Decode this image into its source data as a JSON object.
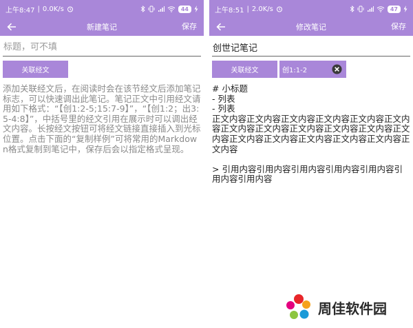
{
  "left": {
    "status": {
      "time": "上午8:47",
      "speed": "0.0K/s",
      "battery": "44"
    },
    "appbar": {
      "title": "新建笔记",
      "save_label": "保存"
    },
    "title_input": {
      "value": "",
      "placeholder": "标题，可不填"
    },
    "verse_button_label": "关联经文",
    "help_text": "添加关联经文后，在阅读时会在该节经文后添加笔记标志，可以快速调出此笔记。笔记正文中引用经文请用如下格式：“【创1:2-5;15:7-9】”，“【创1:2；出3:5-4:8】”，中括号里的经文引用在展示时可以调出经文内容。长按经文按钮可将经文链接直接插入到光标位置。点击下面的“复制样例”可将常用的Markdown格式复制到笔记中，保存后会以指定格式呈现。"
  },
  "right": {
    "status": {
      "time": "上午8:51",
      "speed": "2.0K/s",
      "battery": "47"
    },
    "appbar": {
      "title": "修改笔记",
      "save_label": "保存"
    },
    "title_input": {
      "value": "创世记笔记",
      "placeholder": ""
    },
    "verse_button_label": "关联经文",
    "verse_chip_label": "创1:1-2",
    "body_lines": [
      "# 小标题",
      "- 列表",
      "- 列表",
      "正文内容正文内容正文内容正文内容正文内容正文内容正文内容正文内容正文内容正文内容正文内容正文内容正文内容正文内容正文内容正文内容正文内容正文内容",
      "",
      "> 引用内容引用内容引用内容引用内容引用内容引用内容引用内容"
    ]
  },
  "watermark": {
    "text": "周佳软件园"
  },
  "colors": {
    "accent": "#a987d9",
    "help_text": "#8a8a8a"
  }
}
